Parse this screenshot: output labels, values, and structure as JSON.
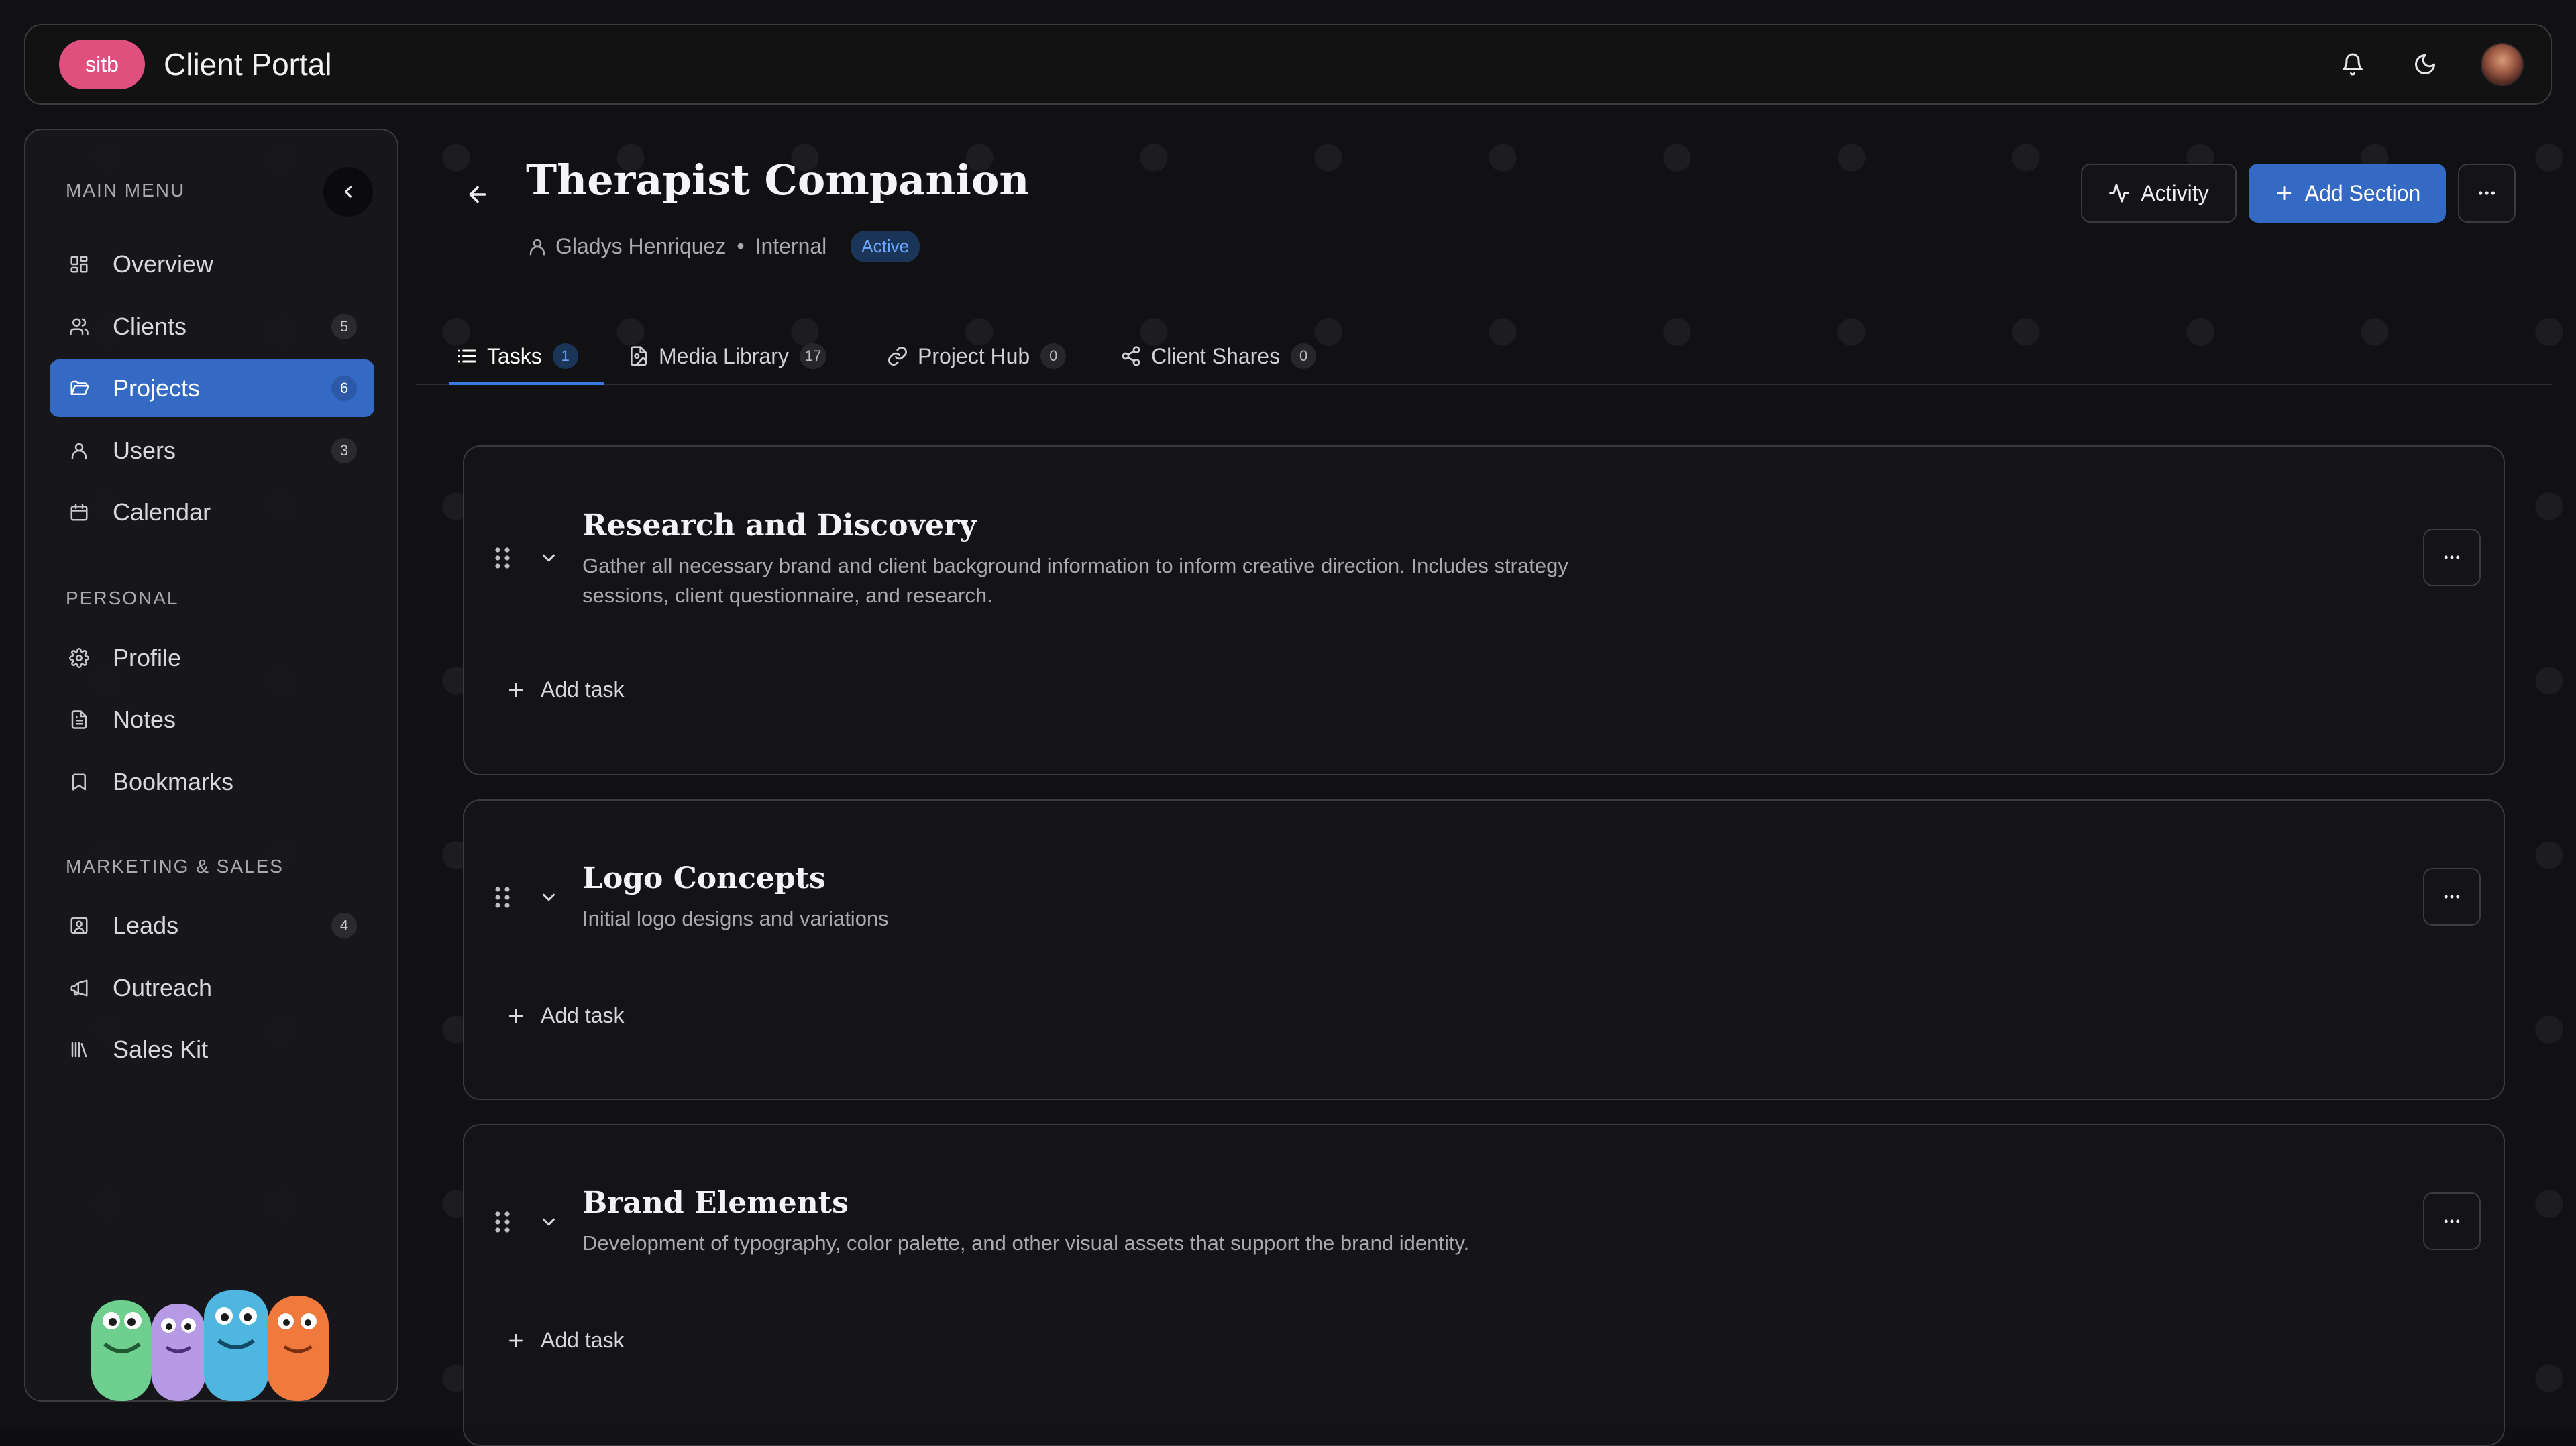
{
  "header": {
    "logo_text": "sitb",
    "app_title": "Client Portal"
  },
  "sidebar": {
    "main_menu_label": "MAIN MENU",
    "personal_label": "PERSONAL",
    "marketing_label": "MARKETING & SALES",
    "main_items": [
      {
        "label": "Overview",
        "icon": "grid-icon",
        "count": ""
      },
      {
        "label": "Clients",
        "icon": "users-icon",
        "count": "5"
      },
      {
        "label": "Projects",
        "icon": "folder-icon",
        "count": "6",
        "active": true
      },
      {
        "label": "Users",
        "icon": "user-icon",
        "count": "3"
      },
      {
        "label": "Calendar",
        "icon": "calendar-icon",
        "count": ""
      }
    ],
    "personal_items": [
      {
        "label": "Profile",
        "icon": "gear-icon"
      },
      {
        "label": "Notes",
        "icon": "document-icon"
      },
      {
        "label": "Bookmarks",
        "icon": "bookmark-icon"
      }
    ],
    "marketing_items": [
      {
        "label": "Leads",
        "icon": "contact-icon",
        "count": "4"
      },
      {
        "label": "Outreach",
        "icon": "megaphone-icon",
        "count": ""
      },
      {
        "label": "Sales Kit",
        "icon": "library-icon",
        "count": ""
      }
    ]
  },
  "project": {
    "title": "Therapist Companion",
    "owner": "Gladys Henriquez",
    "separator": "•",
    "type": "Internal",
    "status": "Active",
    "activity_label": "Activity",
    "add_section_label": "Add Section"
  },
  "tabs": [
    {
      "label": "Tasks",
      "count": "1",
      "icon": "list-icon",
      "active": true
    },
    {
      "label": "Media Library",
      "count": "17",
      "icon": "image-file-icon"
    },
    {
      "label": "Project Hub",
      "count": "0",
      "icon": "link-icon"
    },
    {
      "label": "Client Shares",
      "count": "0",
      "icon": "share-icon"
    }
  ],
  "sections": [
    {
      "title": "Research and Discovery",
      "description": "Gather all necessary brand and client background information to inform creative direction. Includes strategy sessions, client questionnaire, and research.",
      "add_task_label": "Add task"
    },
    {
      "title": "Logo Concepts",
      "description": "Initial logo designs and variations",
      "add_task_label": "Add task"
    },
    {
      "title": "Brand Elements",
      "description": "Development of typography, color palette, and other visual assets that support the brand identity.",
      "add_task_label": "Add task"
    }
  ],
  "colors": {
    "accent": "#3469c4",
    "brand_pink": "#e0507e",
    "status_blue": "#6ea8ff"
  }
}
